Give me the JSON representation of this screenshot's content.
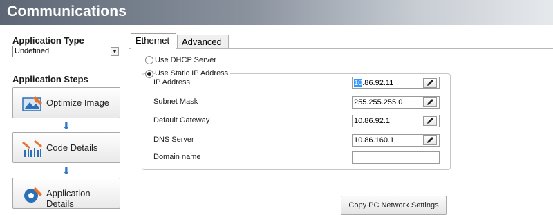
{
  "window": {
    "title": "Communications"
  },
  "left": {
    "application_type_heading": "Application Type",
    "application_type_value": "Undefined",
    "application_steps_heading": "Application Steps",
    "steps": [
      {
        "label": "Optimize Image",
        "icon": "optimize-image-icon"
      },
      {
        "label": "Code Details",
        "icon": "code-details-icon"
      },
      {
        "label": "Application Details",
        "icon": "application-details-icon"
      }
    ],
    "step_arrow": "⬇"
  },
  "tabs": [
    {
      "label": "Ethernet",
      "active": true
    },
    {
      "label": "Advanced",
      "active": false
    }
  ],
  "ethernet": {
    "dhcp_label": "Use DHCP Server",
    "dhcp_selected": false,
    "static_label": "Use Static IP Address",
    "static_selected": true,
    "fields": [
      {
        "label": "IP Address",
        "value_selected": "10",
        "value_rest": ".86.92.11",
        "has_edit": true
      },
      {
        "label": "Subnet Mask",
        "value": "255.255.255.0",
        "has_edit": true
      },
      {
        "label": "Default Gateway",
        "value": "10.86.92.1",
        "has_edit": true
      },
      {
        "label": "DNS Server",
        "value": "10.86.160.1",
        "has_edit": true
      },
      {
        "label": "Domain name",
        "value": "",
        "has_edit": false
      }
    ],
    "copy_button": "Copy PC Network Settings"
  },
  "colors": {
    "arrow": "#2e78c2",
    "selection": "#3399ff",
    "icon_blue": "#2b6fb8",
    "icon_orange": "#e8722a"
  }
}
